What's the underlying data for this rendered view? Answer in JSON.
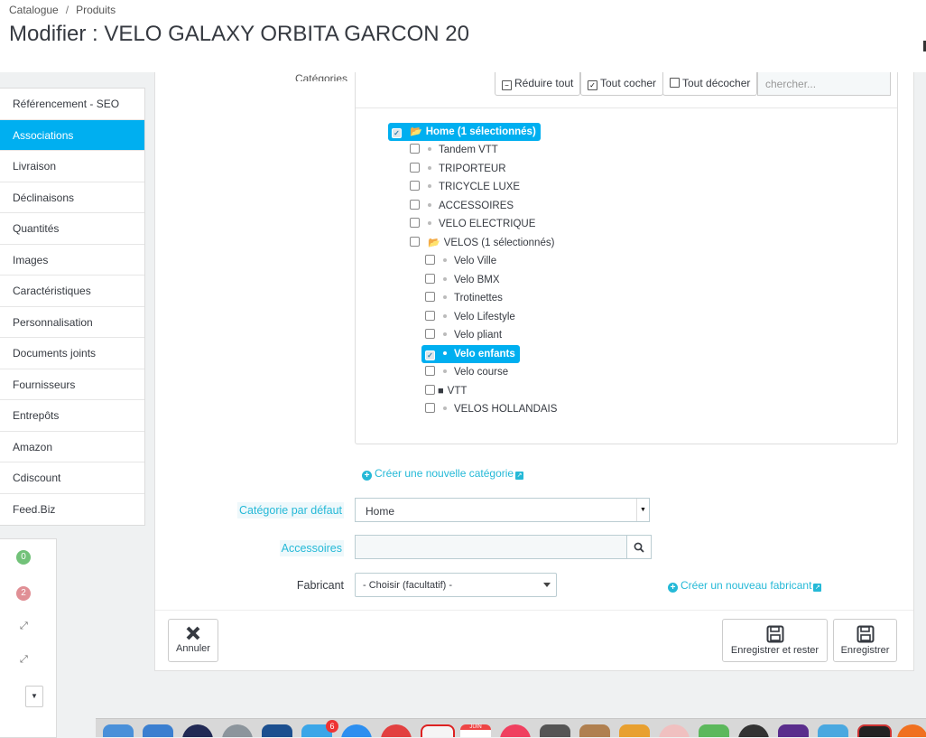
{
  "breadcrumb": {
    "item1": "Catalogue",
    "item2": "Produits"
  },
  "page_title": "Modifier : VELO GALAXY ORBITA GARCON 20",
  "sidebar": {
    "items": [
      {
        "label": "Référencement - SEO"
      },
      {
        "label": "Associations",
        "active": true
      },
      {
        "label": "Livraison"
      },
      {
        "label": "Déclinaisons"
      },
      {
        "label": "Quantités"
      },
      {
        "label": "Images"
      },
      {
        "label": "Caractéristiques"
      },
      {
        "label": "Personnalisation"
      },
      {
        "label": "Documents joints"
      },
      {
        "label": "Fournisseurs"
      },
      {
        "label": "Entrepôts"
      },
      {
        "label": "Amazon"
      },
      {
        "label": "Cdiscount"
      },
      {
        "label": "Feed.Biz"
      }
    ]
  },
  "mini_panel": {
    "badge_green": "0",
    "badge_red": "2"
  },
  "categories": {
    "label": "Catégories associées",
    "collapse_all": "Réduire tout",
    "check_all": "Tout cocher",
    "uncheck_all": "Tout décocher",
    "search_placeholder": "chercher...",
    "tree": {
      "home": "Home (1 sélectionnés)",
      "tandem": "Tandem VTT",
      "triporteur": "TRIPORTEUR",
      "tricycle": "TRICYCLE LUXE",
      "accessoires": "ACCESSOIRES",
      "velo_electrique": "VELO ELECTRIQUE",
      "velos": "VELOS (1 sélectionnés)",
      "velo_ville": "Velo Ville",
      "velo_bmx": "Velo BMX",
      "trotinettes": "Trotinettes",
      "velo_lifestyle": "Velo Lifestyle",
      "velo_pliant": "Velo pliant",
      "velo_enfants": "Velo enfants",
      "velo_course": "Velo course",
      "vtt": "VTT",
      "velos_hollandais": "VELOS HOLLANDAIS"
    },
    "new_category_link": "Créer une nouvelle catégorie"
  },
  "form": {
    "default_category_label": "Catégorie par défaut",
    "default_category_value": "Home",
    "accessories_label": "Accessoires",
    "manufacturer_label": "Fabricant",
    "manufacturer_value": "- Choisir (facultatif) -",
    "new_manufacturer_link": "Créer un nouveau fabricant"
  },
  "actions": {
    "cancel": "Annuler",
    "save_and_stay": "Enregistrer et rester",
    "save": "Enregistrer"
  },
  "dock": {
    "mail_badge": "6",
    "calendar_month": "JUIN"
  },
  "colors": {
    "accent": "#00aff0",
    "link": "#25b9d7"
  }
}
